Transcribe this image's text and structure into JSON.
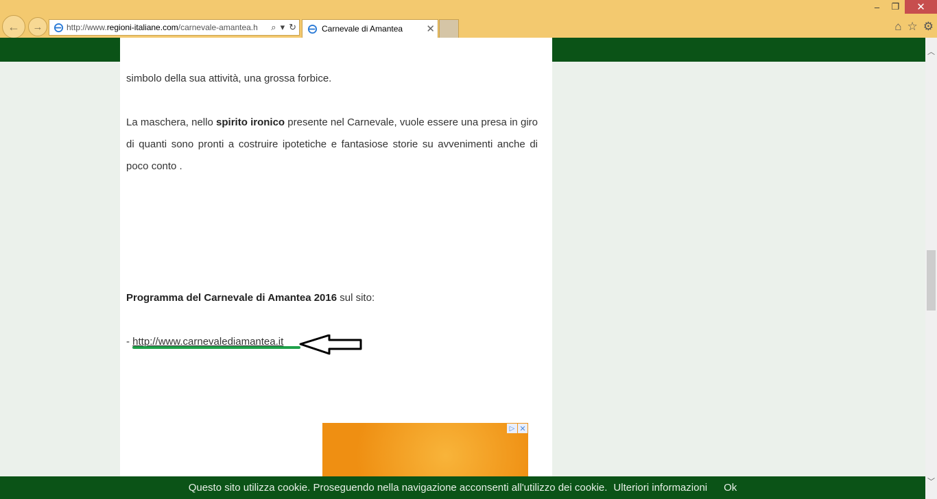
{
  "browser": {
    "address_prefix": "http://www.",
    "address_domain": "regioni-italiane.com",
    "address_rest": "/carnevale-amantea.h",
    "tab_title": "Carnevale di Amantea",
    "window_controls": {
      "minimize": "–",
      "restore": "❐",
      "close": "✕"
    },
    "icons": [
      "back-icon",
      "forward-icon",
      "ie-icon",
      "search-icon",
      "refresh-icon",
      "close-icon",
      "home-icon",
      "favorites-star-icon",
      "gear-icon"
    ]
  },
  "article": {
    "paragraph1_line": "simbolo della sua attività, una grossa forbice.",
    "paragraph2_before": "La maschera, nello ",
    "paragraph2_bold": "spirito ironico",
    "paragraph2_after": " presente nel Carnevale, vuole essere una presa in giro di quanti sono pronti a costruire ipotetiche e fantasiose storie su avvenimenti anche di poco conto .",
    "program_bold": "Programma del Carnevale di Amantea 2016",
    "program_after": " sul sito:",
    "link_prefix": "- ",
    "link_text": "http://www.carnevalediamantea.it"
  },
  "ad": {
    "adchoices_glyph": "▷",
    "close_glyph": "✕"
  },
  "cookie_bar": {
    "message": "Questo sito utilizza cookie. Proseguendo nella navigazione acconsenti all'utilizzo dei cookie.",
    "more_info": "Ulteriori informazioni",
    "ok": "Ok"
  },
  "colors": {
    "site_green": "#0b5317",
    "chrome": "#f3c96f",
    "annotation_underline": "#1fa14a"
  }
}
